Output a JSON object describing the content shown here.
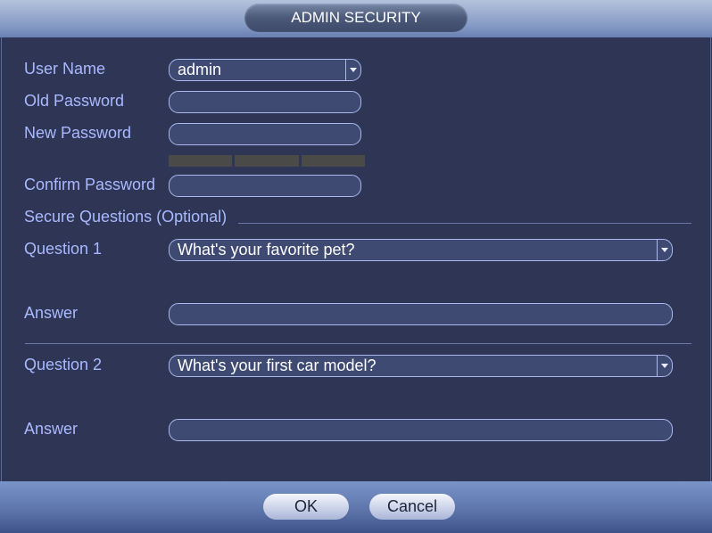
{
  "window": {
    "title": "ADMIN SECURITY"
  },
  "form": {
    "user_name": {
      "label": "User Name",
      "value": "admin"
    },
    "old_password": {
      "label": "Old Password",
      "value": ""
    },
    "new_password": {
      "label": "New Password",
      "value": ""
    },
    "confirm_password": {
      "label": "Confirm Password",
      "value": ""
    },
    "secure_questions_label": "Secure Questions (Optional)",
    "question1": {
      "label": "Question 1",
      "value": "What's your favorite pet?"
    },
    "answer1": {
      "label": "Answer",
      "value": ""
    },
    "question2": {
      "label": "Question 2",
      "value": "What's your first car model?"
    },
    "answer2": {
      "label": "Answer",
      "value": ""
    }
  },
  "footer": {
    "ok_label": "OK",
    "cancel_label": "Cancel"
  },
  "colors": {
    "label": "#a9b9ff",
    "panel": "#2f3655",
    "strength_empty": "#4a4a48"
  }
}
